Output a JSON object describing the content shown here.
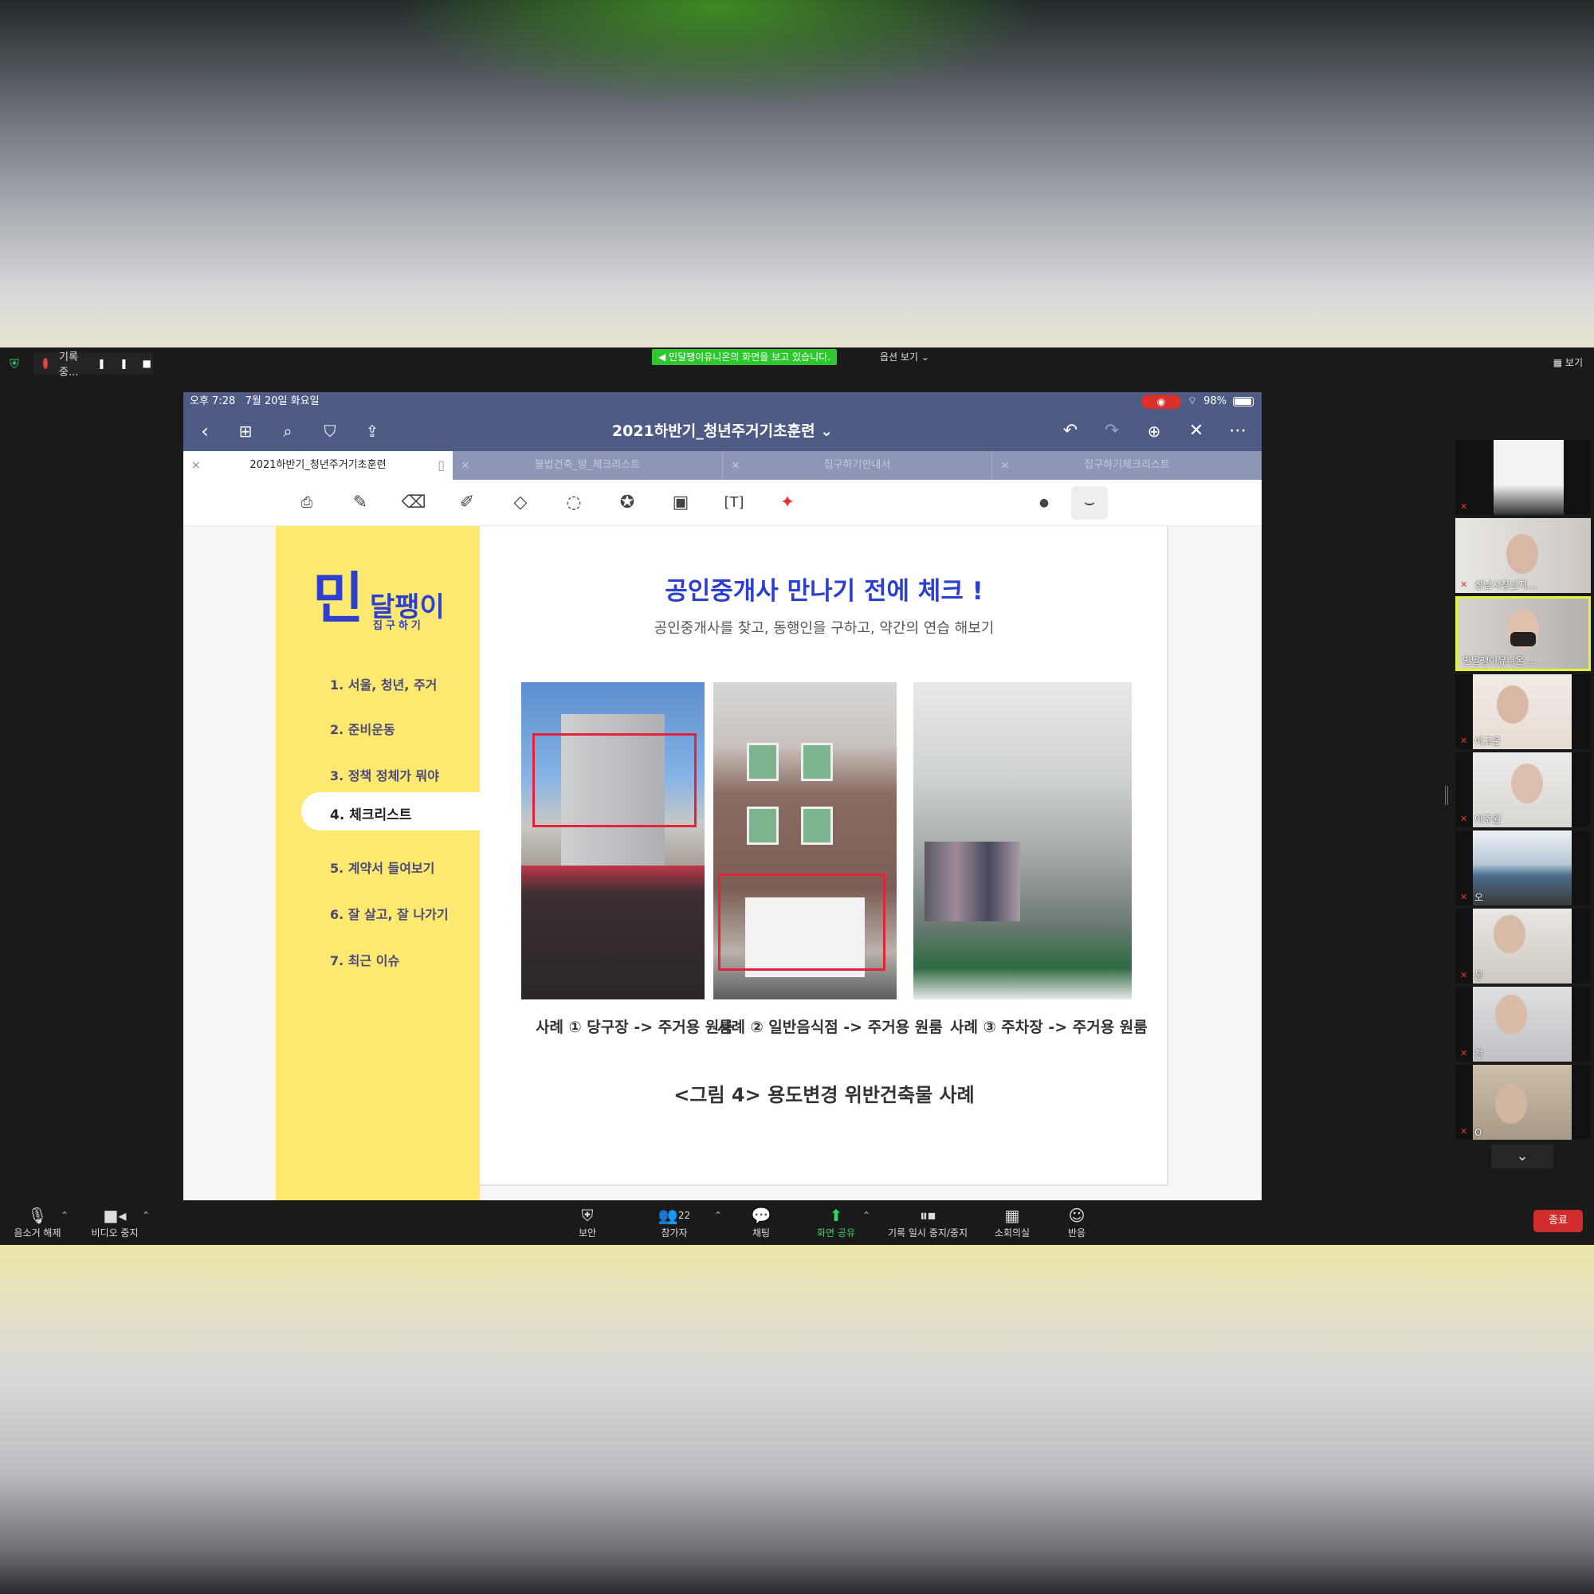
{
  "zoom": {
    "recording_label": "기록 중...",
    "viewing_banner": "민달팽이유니온의 화면을 보고 있습니다.",
    "view_options": "옵션 보기 ⌄",
    "view_button": "보기",
    "participant_count": "22",
    "toolbar": {
      "unmute": "음소거 해제",
      "stop_video": "비디오 중지",
      "security": "보안",
      "participants": "참가자",
      "chat": "채팅",
      "share_screen": "화면 공유",
      "pause_stop_recording": "기록 일시 중지/중지",
      "breakout_rooms": "소회의실",
      "reactions": "반응",
      "end": "종료"
    },
    "gallery": [
      {
        "name": "",
        "muted": true
      },
      {
        "name": "성남시청년지...",
        "muted": true
      },
      {
        "name": "민달팽이유니온 ...",
        "muted": false,
        "selected": true
      },
      {
        "name": "이고은",
        "muted": true
      },
      {
        "name": "이주원",
        "muted": true
      },
      {
        "name": "오",
        "muted": true
      },
      {
        "name": "문",
        "muted": true
      },
      {
        "name": "전",
        "muted": true
      },
      {
        "name": "O",
        "muted": true
      }
    ]
  },
  "ipad": {
    "status_time": "오후 7:28",
    "status_date": "7월 20일 화요일",
    "battery": "98%",
    "doc_title": "2021하반기_청년주거기초훈련 ⌄",
    "tabs": [
      {
        "label": "2021하반기_청년주거기초훈련",
        "active": true
      },
      {
        "label": "불법건축_방_체크리스트",
        "active": false
      },
      {
        "label": "집구하기안내서",
        "active": false
      },
      {
        "label": "집구하기체크리스트",
        "active": false
      }
    ]
  },
  "slide": {
    "logo_big": "민",
    "logo_rest": "달팽이",
    "logo_sub": "집구하기",
    "menu": [
      "1. 서울, 청년, 주거",
      "2. 준비운동",
      "3. 정책 정체가 뭐야",
      "4. 체크리스트",
      "5. 계약서 들여보기",
      "6. 잘 살고, 잘 나가기",
      "7. 최근 이슈"
    ],
    "title": "공인중개사 만나기 전에 체크 !",
    "subtitle": "공인중개사를 찾고, 동행인을 구하고, 약간의 연습 해보기",
    "captions": [
      "사례 ① 당구장 -> 주거용 원룸",
      "사례 ② 일반음식점 -> 주거용 원룸",
      "사례 ③ 주차장 -> 주거용 원룸"
    ],
    "figure_caption": "<그림 4> 용도변경 위반건축물 사례"
  }
}
